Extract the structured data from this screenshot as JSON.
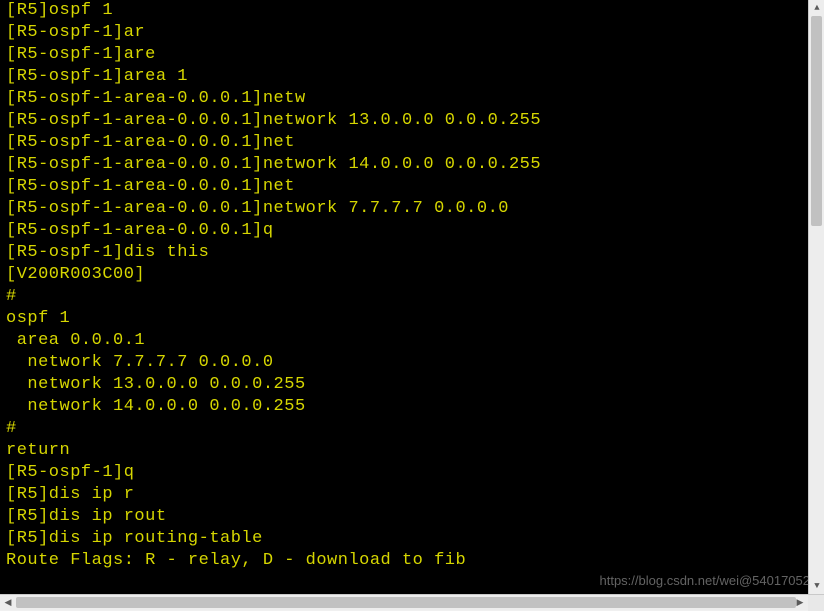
{
  "colors": {
    "bg": "#000000",
    "fg": "#d6d600"
  },
  "terminal": {
    "lines": [
      "[R5]ospf 1",
      "[R5-ospf-1]ar",
      "[R5-ospf-1]are",
      "[R5-ospf-1]area 1",
      "[R5-ospf-1-area-0.0.0.1]netw",
      "[R5-ospf-1-area-0.0.0.1]network 13.0.0.0 0.0.0.255",
      "[R5-ospf-1-area-0.0.0.1]net",
      "[R5-ospf-1-area-0.0.0.1]network 14.0.0.0 0.0.0.255",
      "[R5-ospf-1-area-0.0.0.1]net",
      "[R5-ospf-1-area-0.0.0.1]network 7.7.7.7 0.0.0.0",
      "[R5-ospf-1-area-0.0.0.1]q",
      "[R5-ospf-1]dis this",
      "[V200R003C00]",
      "#",
      "ospf 1",
      " area 0.0.0.1",
      "  network 7.7.7.7 0.0.0.0",
      "  network 13.0.0.0 0.0.0.255",
      "  network 14.0.0.0 0.0.0.255",
      "#",
      "return",
      "[R5-ospf-1]q",
      "[R5]dis ip r",
      "[R5]dis ip rout",
      "[R5]dis ip routing-table",
      "Route Flags: R - relay, D - download to fib"
    ]
  },
  "scroll": {
    "up_glyph": "▲",
    "down_glyph": "▼",
    "left_glyph": "◀",
    "right_glyph": "▶"
  },
  "watermark": "https://blog.csdn.net/wei@54017052"
}
